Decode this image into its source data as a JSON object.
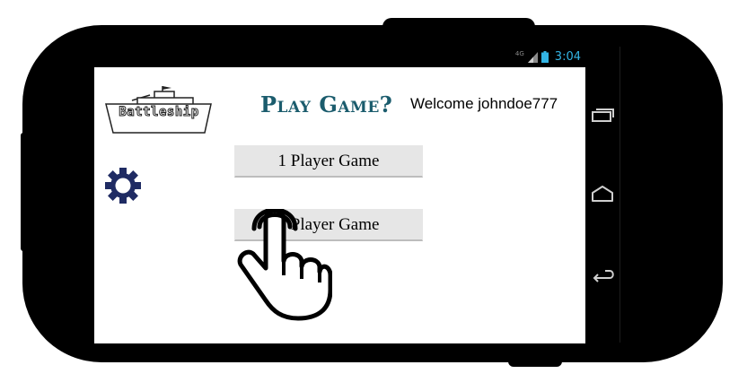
{
  "status_bar": {
    "network_type": "4G",
    "time": "3:04",
    "icons": [
      "signal-icon",
      "battery-icon"
    ]
  },
  "logo": {
    "text": "Battleship",
    "icon": "battleship-logo-icon"
  },
  "header": {
    "title": "Play Game?",
    "welcome": "Welcome johndoe777"
  },
  "settings": {
    "icon": "gear-icon"
  },
  "menu": {
    "one_player_label": "1 Player Game",
    "two_player_label": "2 Player Game"
  },
  "overlay": {
    "icon": "hand-pointer-icon"
  },
  "nav_bar": {
    "icons": [
      "recent-apps-icon",
      "home-icon",
      "back-icon"
    ]
  },
  "colors": {
    "title": "#1b5c6d",
    "gear": "#1f2b63",
    "clock": "#33b5e5",
    "button_bg": "#e6e6e6"
  }
}
